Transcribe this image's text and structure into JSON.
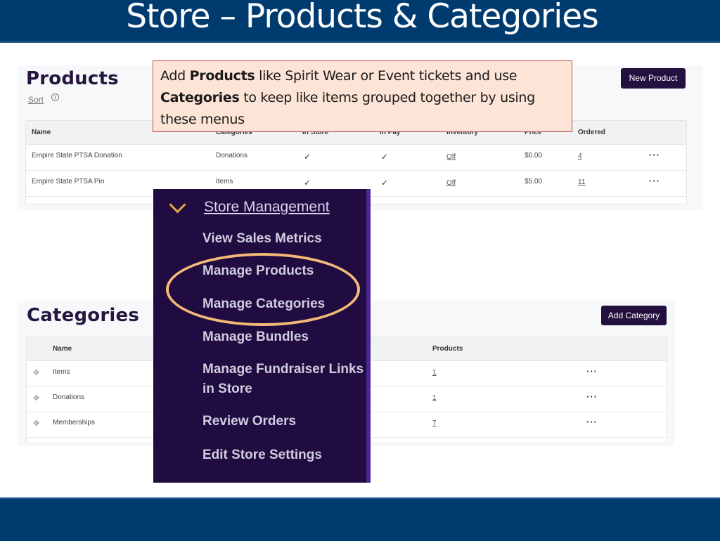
{
  "slide": {
    "title": "Store – Products & Categories"
  },
  "callout": {
    "prefix": "Add ",
    "bold1": "Products",
    "mid": " like Spirit Wear or Event tickets and use ",
    "bold2": "Categories",
    "suffix": " to keep like items grouped together by using these menus"
  },
  "products": {
    "title": "Products",
    "sort_label": "Sort",
    "info_icon": "ⓘ",
    "new_button": "New Product",
    "columns": [
      "Name",
      "Categories",
      "In Store",
      "In Pay",
      "Inventory",
      "Price",
      "Ordered"
    ],
    "rows": [
      {
        "name": "Empire State PTSA Donation",
        "category": "Donations",
        "in_store": "✓",
        "in_pay": "✓",
        "inventory": "Off",
        "price": "$0.00",
        "ordered": "4",
        "actions": "···"
      },
      {
        "name": "Empire State PTSA Pin",
        "category": "Items",
        "in_store": "✓",
        "in_pay": "✓",
        "inventory": "Off",
        "price": "$5.00",
        "ordered": "11",
        "actions": "···"
      }
    ]
  },
  "categories": {
    "title": "Categories",
    "add_button": "Add Category",
    "columns": [
      "Name",
      "Products"
    ],
    "rows": [
      {
        "name": "Items",
        "products": "1",
        "actions": "···"
      },
      {
        "name": "Donations",
        "products": "1",
        "actions": "···"
      },
      {
        "name": "Memberships",
        "products": "7",
        "actions": "···"
      }
    ],
    "move_icon": "✥"
  },
  "menu": {
    "header": "Store Management",
    "items": [
      "View Sales Metrics",
      "Manage Products",
      "Manage Categories",
      "Manage Bundles",
      "Manage Fundraiser Links in Store",
      "Review Orders",
      "Edit Store Settings"
    ],
    "highlight_color": "#f4b879",
    "background_color": "#200c40"
  }
}
